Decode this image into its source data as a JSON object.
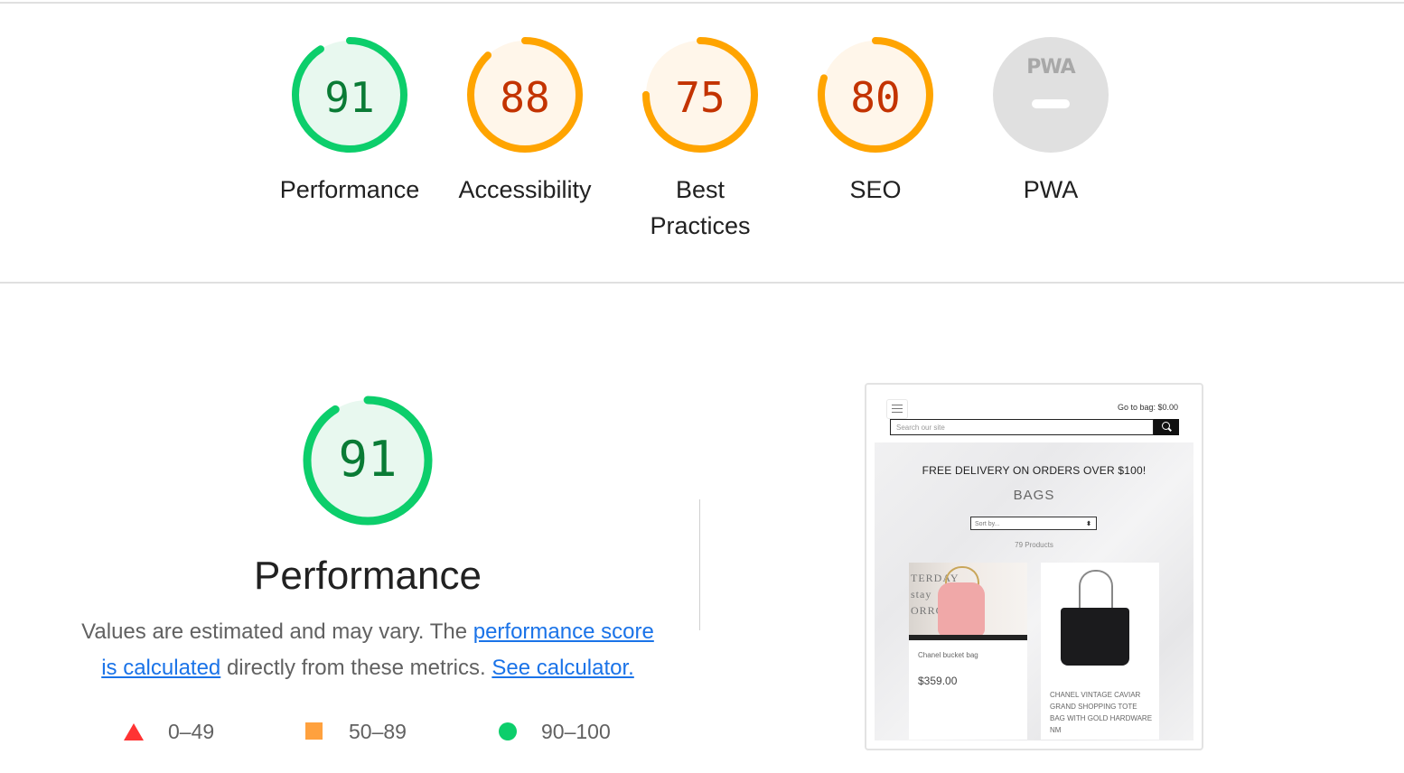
{
  "colors": {
    "pass": "#0cce6b",
    "pass_text": "#0a7b35",
    "average": "#ffa400",
    "average_text": "#c33300",
    "fail": "#ff3333",
    "na": "#e0e0e0"
  },
  "categories": [
    {
      "label": "Performance",
      "score": "91",
      "fraction": 0.91,
      "rating": "pass"
    },
    {
      "label": "Accessibility",
      "score": "88",
      "fraction": 0.88,
      "rating": "average"
    },
    {
      "label": "Best Practices",
      "score": "75",
      "fraction": 0.75,
      "rating": "average"
    },
    {
      "label": "SEO",
      "score": "80",
      "fraction": 0.8,
      "rating": "average"
    },
    {
      "label": "PWA",
      "badge": "PWA",
      "rating": "na"
    }
  ],
  "performance": {
    "score": "91",
    "fraction": 0.91,
    "title": "Performance",
    "desc_prefix": "Values are estimated and may vary. The ",
    "link_score": "performance score is calculated",
    "desc_middle": " directly from these metrics. ",
    "link_calculator": "See calculator."
  },
  "legend": [
    {
      "icon": "triangle-icon",
      "range": "0–49"
    },
    {
      "icon": "square-icon",
      "range": "50–89"
    },
    {
      "icon": "circle-icon",
      "range": "90–100"
    }
  ],
  "screenshot": {
    "bag_label": "Go to bag: $0.00",
    "search_placeholder": "Search our site",
    "promo": "FREE DELIVERY ON ORDERS OVER $100!",
    "category": "BAGS",
    "sort_placeholder": "Sort by...",
    "product_count": "79 Products",
    "product1_image_text": "TERDAY\nstay\nORROW",
    "product1_name": "Chanel bucket bag",
    "product1_price": "$359.00",
    "product2_name": "CHANEL VINTAGE CAVIAR GRAND SHOPPING TOTE BAG WITH GOLD HARDWARE NM"
  }
}
